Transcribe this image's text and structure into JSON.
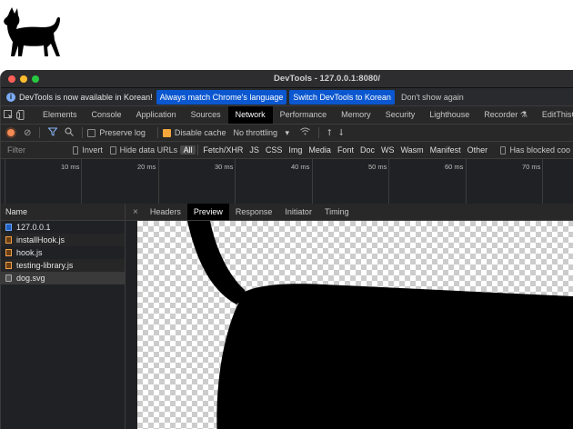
{
  "window": {
    "title": "DevTools - 127.0.0.1:8080/"
  },
  "infobar": {
    "message": "DevTools is now available in Korean!",
    "buttons": [
      "Always match Chrome's language",
      "Switch DevTools to Korean"
    ],
    "dismiss": "Don't show again"
  },
  "panel_tabs": [
    "Elements",
    "Console",
    "Application",
    "Sources",
    "Network",
    "Performance",
    "Memory",
    "Security",
    "Lighthouse",
    "Recorder",
    "EditThisCoo"
  ],
  "active_panel": "Network",
  "toolbar": {
    "preserve_log": "Preserve log",
    "disable_cache": "Disable cache",
    "throttling": "No throttling"
  },
  "filterbar": {
    "placeholder": "Filter",
    "invert": "Invert",
    "hide_data_urls": "Hide data URLs",
    "types": [
      "All",
      "Fetch/XHR",
      "JS",
      "CSS",
      "Img",
      "Media",
      "Font",
      "Doc",
      "WS",
      "Wasm",
      "Manifest",
      "Other"
    ],
    "has_blocked": "Has blocked coo"
  },
  "timeline": {
    "ticks": [
      "10 ms",
      "20 ms",
      "30 ms",
      "40 ms",
      "50 ms",
      "60 ms",
      "70 ms"
    ]
  },
  "requests": {
    "header": "Name",
    "items": [
      {
        "name": "127.0.0.1",
        "kind": "doc"
      },
      {
        "name": "installHook.js",
        "kind": "js"
      },
      {
        "name": "hook.js",
        "kind": "js"
      },
      {
        "name": "testing-library.js",
        "kind": "js"
      },
      {
        "name": "dog.svg",
        "kind": "img"
      }
    ],
    "selected": 4
  },
  "detail_tabs": [
    "Headers",
    "Preview",
    "Response",
    "Initiator",
    "Timing"
  ],
  "active_detail": "Preview",
  "icons": [
    "inspect-icon",
    "device-toggle-icon",
    "record-icon",
    "clear-icon",
    "filter-icon",
    "search-icon",
    "wifi-icon",
    "upload-icon",
    "download-icon",
    "close-icon"
  ]
}
